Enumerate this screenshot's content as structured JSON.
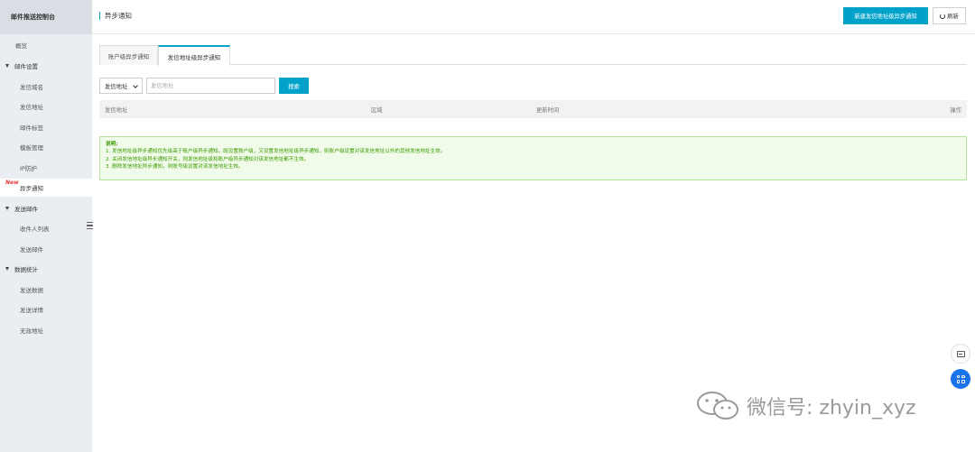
{
  "sidebar": {
    "title": "邮件推送控制台",
    "items": [
      {
        "label": "概览",
        "type": "top"
      },
      {
        "label": "邮件设置",
        "type": "group"
      },
      {
        "label": "发信域名",
        "type": "child"
      },
      {
        "label": "发信地址",
        "type": "child"
      },
      {
        "label": "邮件标签",
        "type": "child"
      },
      {
        "label": "模板管理",
        "type": "child"
      },
      {
        "label": "IP防护",
        "type": "child"
      },
      {
        "label": "异步通知",
        "type": "child",
        "active": true,
        "badge": "New"
      },
      {
        "label": "发送邮件",
        "type": "group"
      },
      {
        "label": "收件人列表",
        "type": "child"
      },
      {
        "label": "发送邮件",
        "type": "child"
      },
      {
        "label": "数据统计",
        "type": "group"
      },
      {
        "label": "发送数据",
        "type": "child"
      },
      {
        "label": "发送详情",
        "type": "child"
      },
      {
        "label": "无效地址",
        "type": "child"
      }
    ]
  },
  "header": {
    "title": "异步通知",
    "primary_button": "新建发信地址级异步通知",
    "refresh_button": "刷新"
  },
  "tabs": [
    {
      "label": "账户级异步通知",
      "active": false
    },
    {
      "label": "发信地址级异步通知",
      "active": true
    }
  ],
  "search": {
    "select_value": "发信地址",
    "placeholder": "发信地址",
    "button": "搜索"
  },
  "table": {
    "columns": [
      "发信地址",
      "区域",
      "更新时间",
      "操作"
    ]
  },
  "info": {
    "title": "说明:",
    "lines": [
      "1. 发信地址级异步通知优先级高于账户级异步通知。既设置账户级，又设置发信地址级异步通知，则账户级设置对该发信地址以外的其他发信地址生效。",
      "2. 关闭发信地址级异步通知开关，则发信地址级和账户级异步通知对该发信地址都不生效。",
      "3. 删除发信地址异步通知，则账号级设置对该发信地址生效。"
    ]
  },
  "floating": {
    "chat_icon": "chat-icon",
    "apps_icon": "apps-grid-icon",
    "apps_color": "#1a73e8"
  },
  "watermark": {
    "text": "微信号: zhyin_xyz"
  },
  "colors": {
    "accent": "#00a2ca",
    "info_text": "#3c9a00",
    "info_bg": "#f0fbe9",
    "badge": "#e4393c"
  }
}
